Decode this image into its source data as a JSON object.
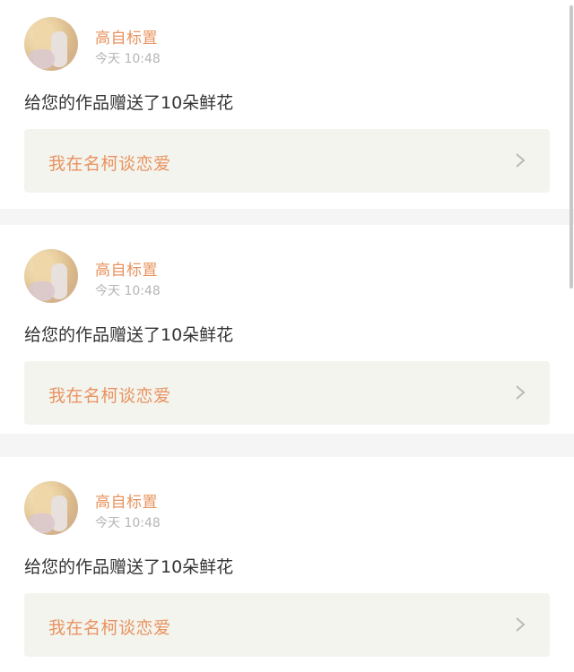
{
  "notifications": [
    {
      "username": "高自标置",
      "time": "今天 10:48",
      "message": "给您的作品赠送了10朵鲜花",
      "work_title": "我在名柯谈恋爱"
    },
    {
      "username": "高自标置",
      "time": "今天 10:48",
      "message": "给您的作品赠送了10朵鲜花",
      "work_title": "我在名柯谈恋爱"
    },
    {
      "username": "高自标置",
      "time": "今天 10:48",
      "message": "给您的作品赠送了10朵鲜花",
      "work_title": "我在名柯谈恋爱"
    }
  ],
  "icons": {
    "chevron": "chevron-right-icon",
    "avatar": "avatar"
  },
  "colors": {
    "accent": "#e8935f",
    "text": "#333333",
    "muted": "#b5b5b5",
    "link_bg": "#f4f4ef",
    "separator": "#f5f5f5"
  }
}
